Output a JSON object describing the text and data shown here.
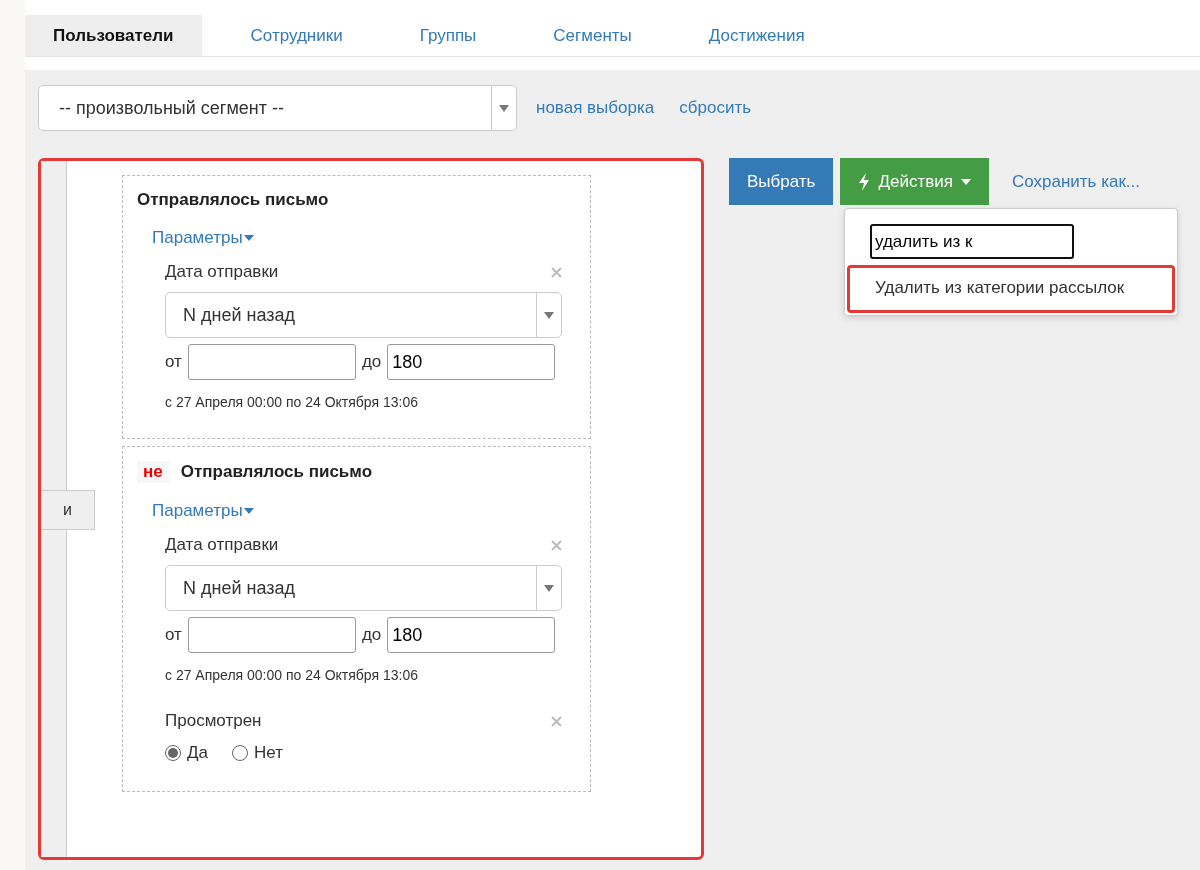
{
  "tabs": [
    {
      "label": "Пользователи",
      "selected": true
    },
    {
      "label": "Сотрудники",
      "selected": false
    },
    {
      "label": "Группы",
      "selected": false
    },
    {
      "label": "Сегменты",
      "selected": false
    },
    {
      "label": "Достижения",
      "selected": false
    }
  ],
  "segment_select": {
    "value": "-- произвольный сегмент --"
  },
  "segment_links": [
    "новая выборка",
    "сбросить"
  ],
  "conditions_panel": {
    "highlighted": true,
    "operator": "и",
    "conditions": [
      {
        "title": "Отправлялось письмо",
        "params_label": "Параметры",
        "filters": [
          {
            "kind": "date_range",
            "label": "Дата отправки",
            "select_value": "N дней назад",
            "from_label": "от",
            "to_label": "до",
            "to_value": "180",
            "summary": "с 27 Апреля 00:00 по 24 Октября 13:06"
          }
        ]
      },
      {
        "negation": "не",
        "title": "Отправлялось письмо",
        "params_label": "Параметры",
        "filters": [
          {
            "kind": "date_range",
            "label": "Дата отправки",
            "select_value": "N дней назад",
            "from_label": "от",
            "to_label": "до",
            "to_value": "180",
            "summary": "с 27 Апреля 00:00 по 24 Октября 13:06"
          },
          {
            "kind": "radio",
            "label": "Просмотрен",
            "options": [
              {
                "label": "Да",
                "selected": true
              },
              {
                "label": "Нет",
                "selected": false
              }
            ]
          }
        ]
      }
    ]
  },
  "actions": {
    "select_button": "Выбрать",
    "actions_button": "Действия",
    "save_link": "Сохранить как...",
    "menu": {
      "search_value": "удалить из к",
      "items": [
        {
          "label": "Удалить из категории рассылок",
          "highlighted": true
        }
      ]
    }
  }
}
